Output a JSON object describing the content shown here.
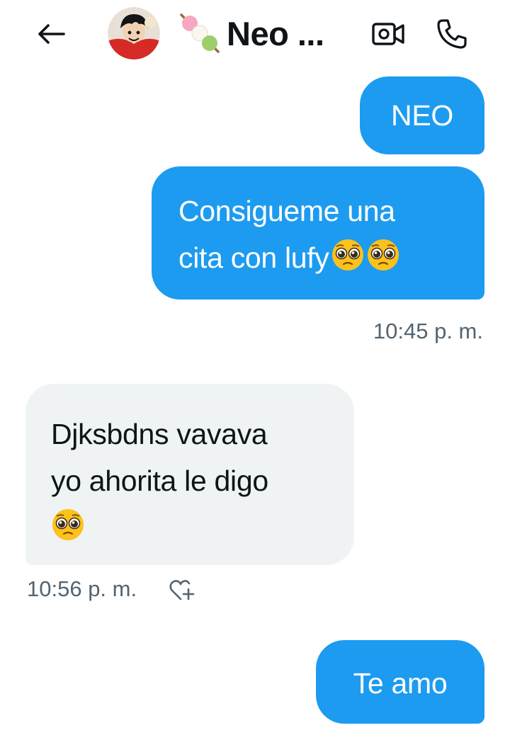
{
  "header": {
    "back_icon": "arrow-left-icon",
    "title": "Neo ...",
    "title_emoji": "dango-emoji",
    "video_icon": "video-camera-icon",
    "call_icon": "phone-icon"
  },
  "messages": [
    {
      "dir": "out",
      "lines": [
        "NEO"
      ]
    },
    {
      "dir": "out",
      "lines": [
        "Consigueme una",
        "cita con lufy"
      ],
      "emoji": "pleading-face-emoji x2",
      "timestamp": "10:45 p. m."
    },
    {
      "dir": "in",
      "lines": [
        "Djksbdns vavava",
        "yo ahorita le digo"
      ],
      "emoji": "pleading-face-emoji",
      "timestamp": "10:56 p. m.",
      "reaction_icon": "heart-plus-icon"
    },
    {
      "dir": "out",
      "lines": [
        "Te amo"
      ]
    }
  ],
  "colors": {
    "outgoing_bubble": "#1d9bf0",
    "incoming_bubble": "#eff3f4",
    "timestamp": "#536471"
  }
}
